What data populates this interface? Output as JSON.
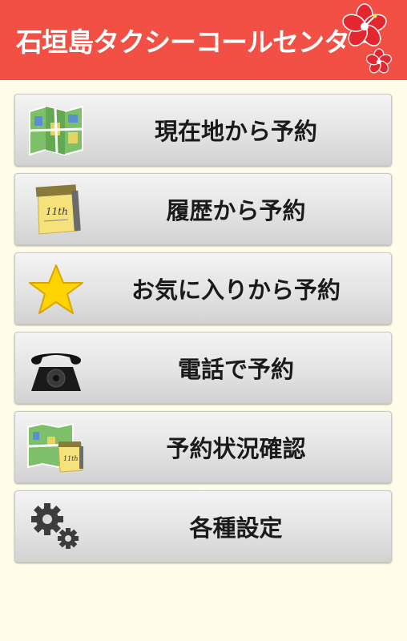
{
  "header": {
    "title": "石垣島タクシーコールセンター",
    "logo_icon": "hibiscus-icon",
    "colors": {
      "background": "#f24f45",
      "text": "#ffffff"
    }
  },
  "menu": [
    {
      "label": "現在地から予約",
      "icon": "map-icon"
    },
    {
      "label": "履歴から予約",
      "icon": "calendar-icon"
    },
    {
      "label": "お気に入りから予約",
      "icon": "star-icon"
    },
    {
      "label": "電話で予約",
      "icon": "telephone-icon"
    },
    {
      "label": "予約状況確認",
      "icon": "map-calendar-icon"
    },
    {
      "label": "各種設定",
      "icon": "gears-icon"
    }
  ],
  "calendar_text": "11th"
}
